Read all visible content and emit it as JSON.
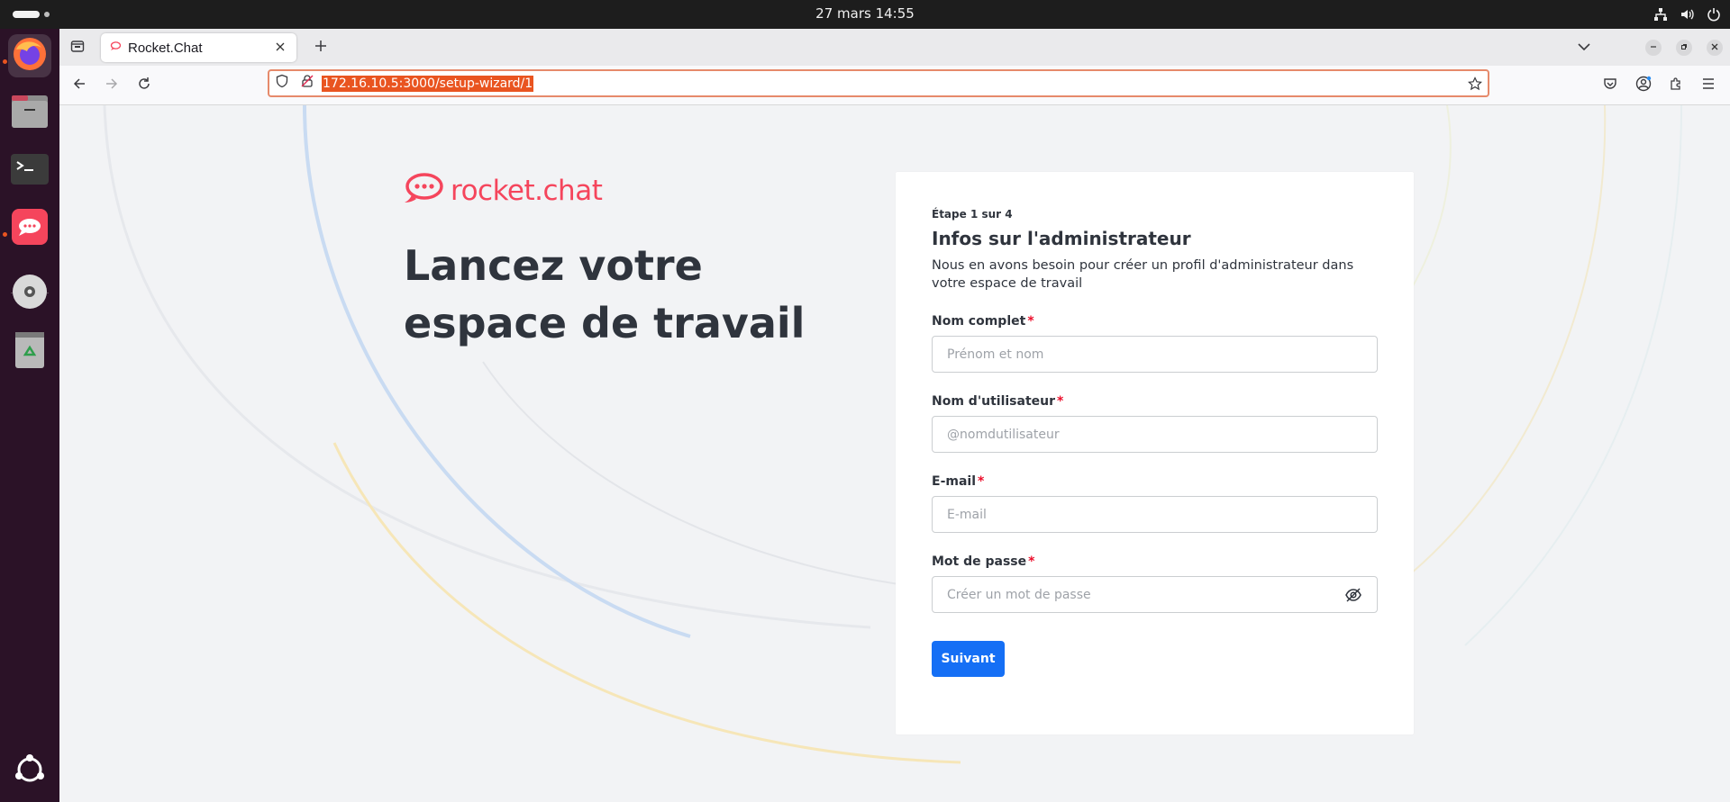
{
  "system": {
    "clock": "27 mars  14:55"
  },
  "browser": {
    "tab_title": "Rocket.Chat",
    "url": "172.16.10.5:3000/setup-wizard/1"
  },
  "page": {
    "logo_text": "rocket.chat",
    "hero_title": "Lancez votre espace de travail"
  },
  "form": {
    "step": "Étape 1 sur 4",
    "title": "Infos sur l'administrateur",
    "subtitle": "Nous en avons besoin pour créer un profil d'administrateur dans votre espace de travail",
    "required_mark": "*",
    "fields": [
      {
        "label": "Nom complet",
        "placeholder": "Prénom et nom"
      },
      {
        "label": "Nom d'utilisateur",
        "placeholder": "@nomdutilisateur"
      },
      {
        "label": "E-mail",
        "placeholder": "E-mail"
      },
      {
        "label": "Mot de passe",
        "placeholder": "Créer un mot de passe"
      }
    ],
    "submit_label": "Suivant"
  },
  "colors": {
    "brand": "#f5455c",
    "primary_button": "#156ff5",
    "url_highlight": "#e95420",
    "dock_bg": "#2b1227"
  }
}
